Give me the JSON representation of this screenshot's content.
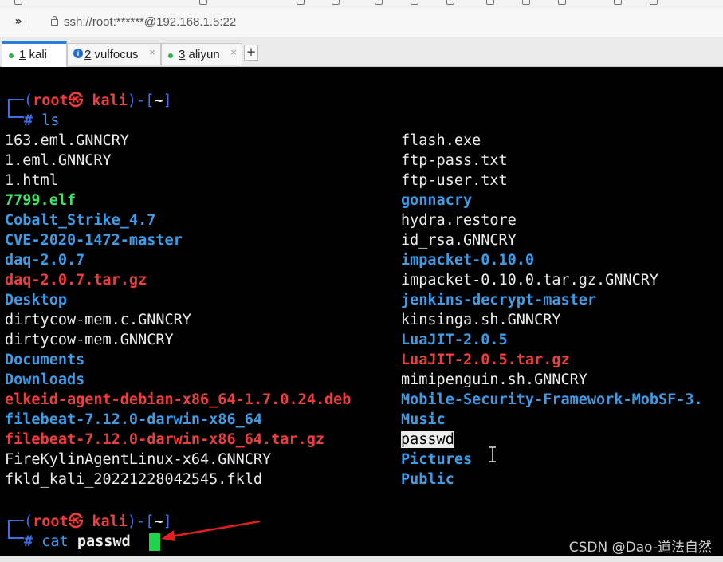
{
  "address_bar": {
    "url": "ssh://root:******@192.168.1.5:22",
    "expand_glyph": "»"
  },
  "tabs": [
    {
      "num": "1",
      "name": " kali",
      "close": ""
    },
    {
      "num": "2",
      "name": " vulfocus",
      "close": "×"
    },
    {
      "num": "3",
      "name": " aliyun",
      "close": "×"
    }
  ],
  "new_tab_glyph": "+",
  "prompt": {
    "open": "(",
    "user": "root",
    "at": "㉿",
    "host": "kali",
    "close": ")-[",
    "dir": "~",
    "end": "]",
    "hash": "# "
  },
  "commands": {
    "first": "ls",
    "second_cmd": "cat ",
    "second_arg": "passwd"
  },
  "ls_left": [
    "163.eml.GNNCRY",
    "1.eml.GNNCRY",
    "1.html",
    "7799.elf",
    "Cobalt_Strike_4.7",
    "CVE-2020-1472-master",
    "daq-2.0.7",
    "daq-2.0.7.tar.gz",
    "Desktop",
    "dirtycow-mem.c.GNNCRY",
    "dirtycow-mem.GNNCRY",
    "Documents",
    "Downloads",
    "elkeid-agent-debian-x86_64-1.7.0.24.deb",
    "filebeat-7.12.0-darwin-x86_64",
    "filebeat-7.12.0-darwin-x86_64.tar.gz",
    "FireKylinAgentLinux-x64.GNNCRY",
    "fkld_kali_20221228042545.fkld"
  ],
  "ls_right": [
    "flash.exe",
    "ftp-pass.txt",
    "ftp-user.txt",
    "gonnacry",
    "hydra.restore",
    "id_rsa.GNNCRY",
    "impacket-0.10.0",
    "impacket-0.10.0.tar.gz.GNNCRY",
    "jenkins-decrypt-master",
    "kinsinga.sh.GNNCRY",
    "LuaJIT-2.0.5",
    "LuaJIT-2.0.5.tar.gz",
    "mimipenguin.sh.GNNCRY",
    "Mobile-Security-Framework-MobSF-3.",
    "Music",
    "passwd",
    "Pictures",
    "Public"
  ],
  "colors": {
    "directory": "#3d9ce8",
    "archive": "#ef3d3d",
    "executable": "#3ee36a",
    "prompt_frame": "#3d6fe8",
    "cursor": "#22d24a",
    "tab_accent": "#2a7fd4"
  },
  "watermark": "CSDN @Dao-道法自然"
}
